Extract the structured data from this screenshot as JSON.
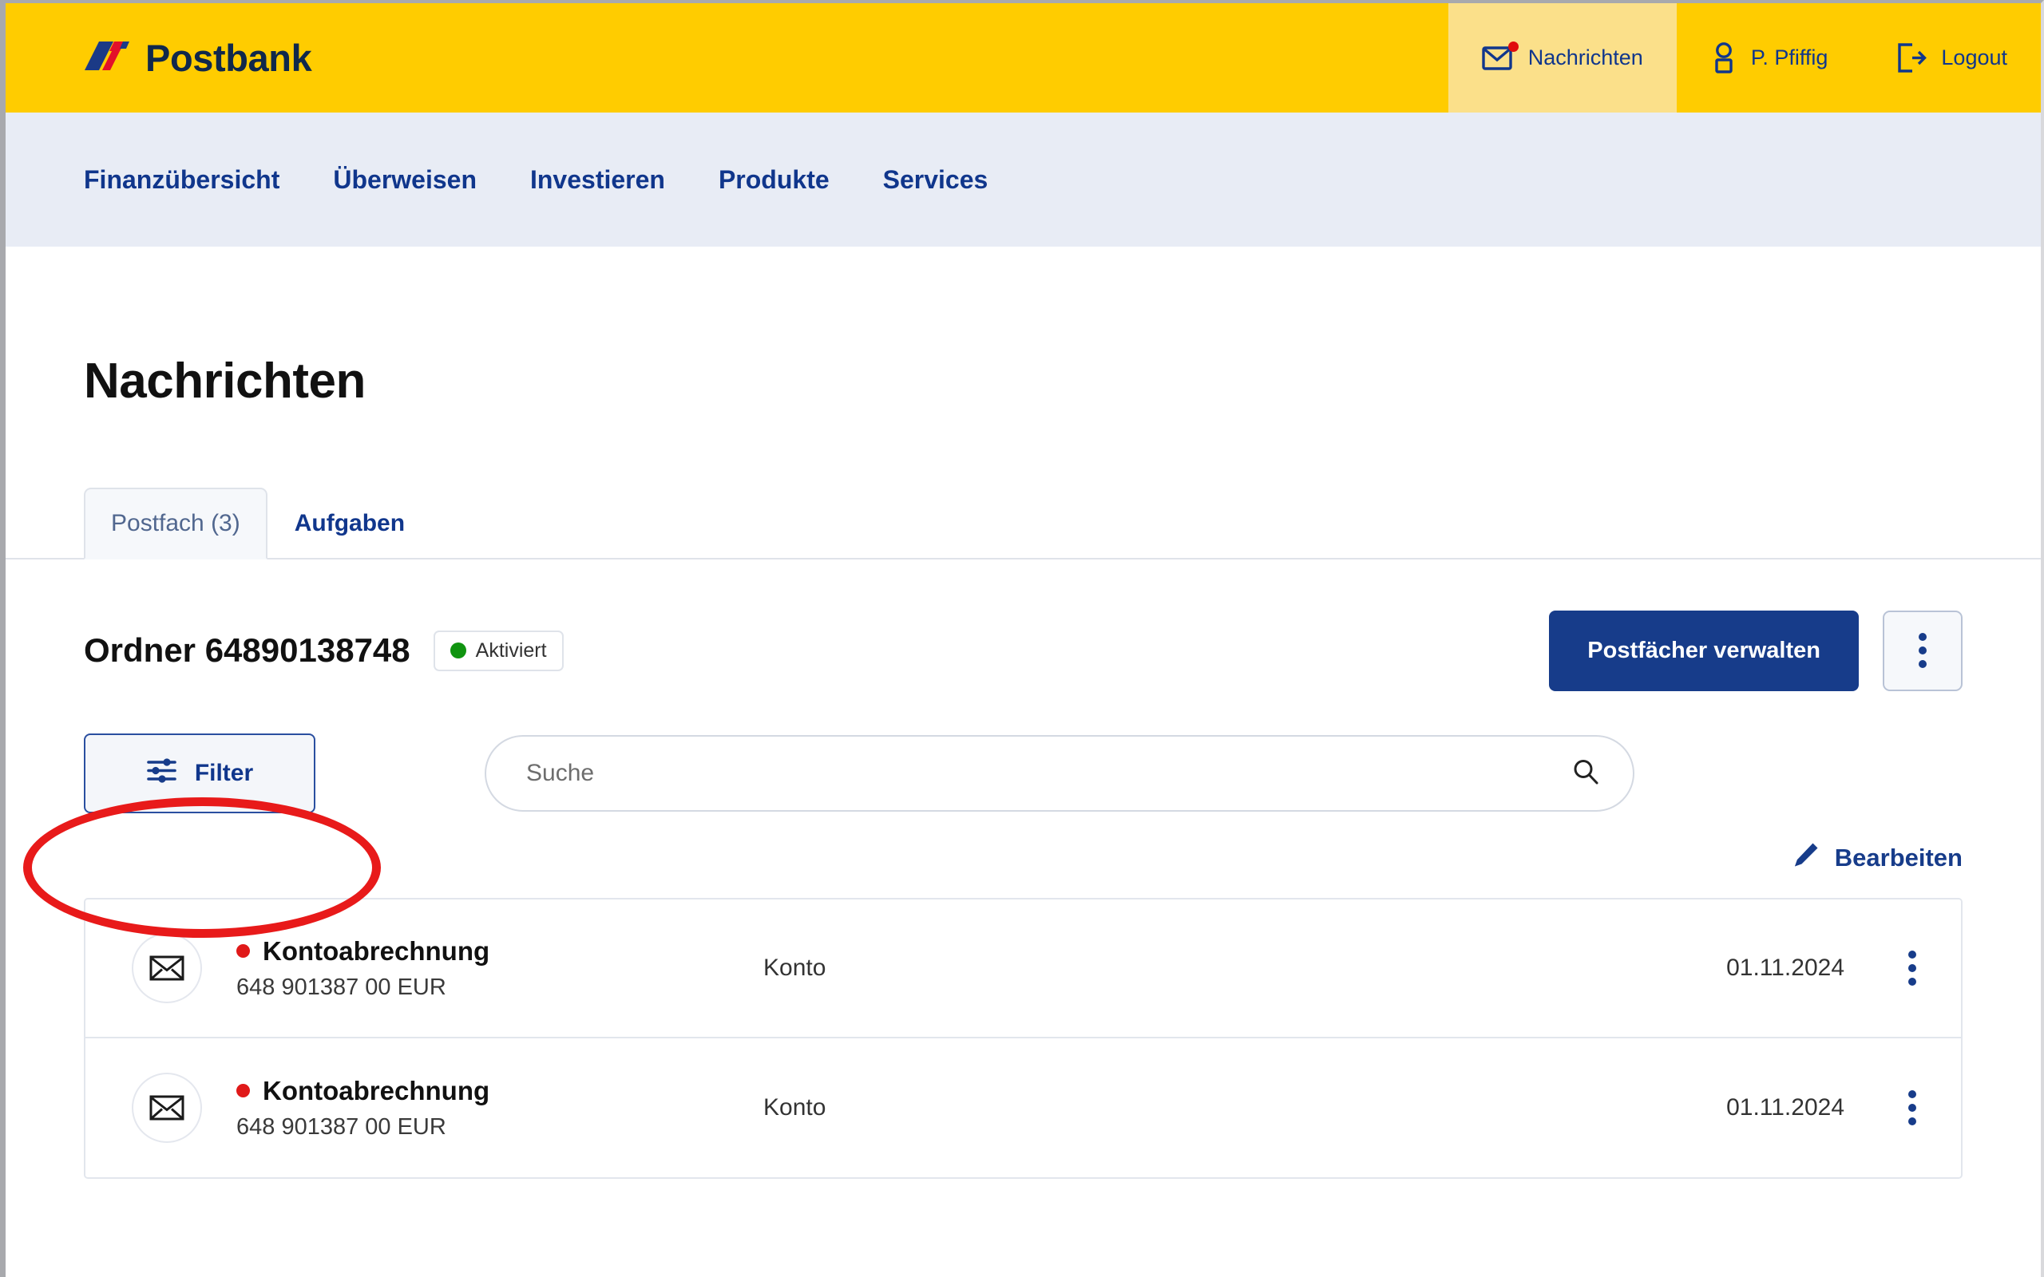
{
  "header": {
    "brand_name": "Postbank",
    "logo_name": "postbank-logo",
    "actions": [
      {
        "label": "Nachrichten",
        "icon": "envelope-icon",
        "active": true,
        "has_badge": true
      },
      {
        "label": "P. Pfiffig",
        "icon": "user-icon",
        "active": false,
        "has_badge": false
      },
      {
        "label": "Logout",
        "icon": "logout-icon",
        "active": false,
        "has_badge": false
      }
    ]
  },
  "nav": {
    "items": [
      {
        "label": "Finanzübersicht"
      },
      {
        "label": "Überweisen"
      },
      {
        "label": "Investieren"
      },
      {
        "label": "Produkte"
      },
      {
        "label": "Services"
      }
    ]
  },
  "page": {
    "title": "Nachrichten",
    "tabs": [
      {
        "label": "Postfach (3)",
        "selected": true
      },
      {
        "label": "Aufgaben",
        "selected": false
      }
    ]
  },
  "folder": {
    "title": "Ordner 64890138748",
    "status_label": "Aktiviert",
    "status_color": "#109410",
    "manage_button": "Postfächer verwalten",
    "more_menu_icon": "kebab-menu-icon"
  },
  "toolbar": {
    "filter_label": "Filter",
    "filter_icon": "filter-sliders-icon",
    "search_placeholder": "Suche",
    "search_value": "",
    "search_icon": "search-icon"
  },
  "edit": {
    "label": "Bearbeiten",
    "icon": "pencil-icon"
  },
  "messages": [
    {
      "icon": "envelope-icon",
      "unread": true,
      "subject": "Kontoabrechnung",
      "account": "648 901387 00 EUR",
      "category": "Konto",
      "date": "01.11.2024",
      "menu_icon": "kebab-menu-icon"
    },
    {
      "icon": "envelope-icon",
      "unread": true,
      "subject": "Kontoabrechnung",
      "account": "648 901387 00 EUR",
      "category": "Konto",
      "date": "01.11.2024",
      "menu_icon": "kebab-menu-icon"
    }
  ],
  "annotation": {
    "shape": "ellipse",
    "color": "#e81a1a",
    "targets": "filter-button"
  },
  "colors": {
    "brand_yellow": "#ffcc00",
    "brand_yellow_active": "#fbe08a",
    "brand_blue": "#10368c",
    "primary_button": "#173c8a",
    "nav_background": "#e8ecf5",
    "unread_red": "#e01919",
    "status_green": "#109410",
    "annotation_red": "#e81a1a"
  }
}
